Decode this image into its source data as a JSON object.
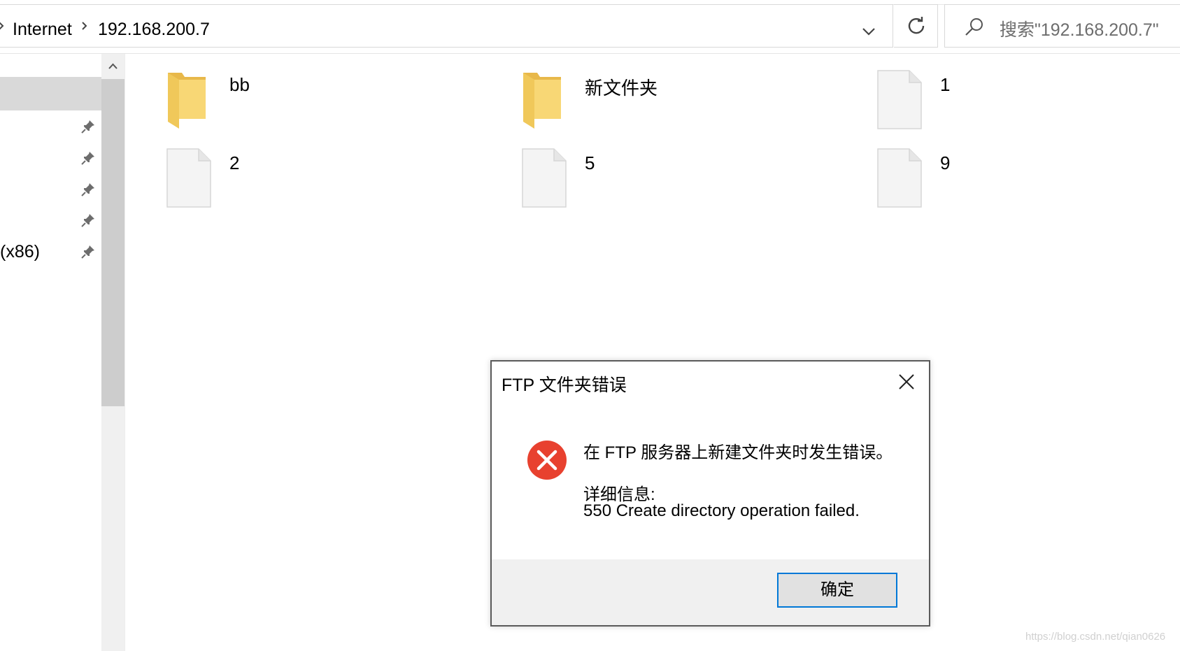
{
  "address_bar": {
    "breadcrumbs": [
      "Internet",
      "192.168.200.7"
    ]
  },
  "search": {
    "placeholder": "搜索\"192.168.200.7\""
  },
  "nav": {
    "items": [
      {
        "label": "",
        "pinned": true
      },
      {
        "label": "",
        "pinned": true
      },
      {
        "label": "",
        "pinned": true
      },
      {
        "label": "",
        "pinned": true
      },
      {
        "label": "(x86)",
        "pinned": true
      }
    ]
  },
  "files": [
    {
      "name": "bb",
      "type": "folder"
    },
    {
      "name": "新文件夹",
      "type": "folder"
    },
    {
      "name": "1",
      "type": "file"
    },
    {
      "name": "2",
      "type": "file"
    },
    {
      "name": "5",
      "type": "file"
    },
    {
      "name": "9",
      "type": "file"
    }
  ],
  "dialog": {
    "title": "FTP 文件夹错误",
    "message": "在 FTP 服务器上新建文件夹时发生错误。",
    "details_label": "详细信息:",
    "details": "550 Create directory operation failed.",
    "ok_label": "确定"
  },
  "watermark": "https://blog.csdn.net/qian0626",
  "colors": {
    "folder": "#f8d775",
    "error_red": "#e8412f",
    "accent": "#0078d7"
  }
}
